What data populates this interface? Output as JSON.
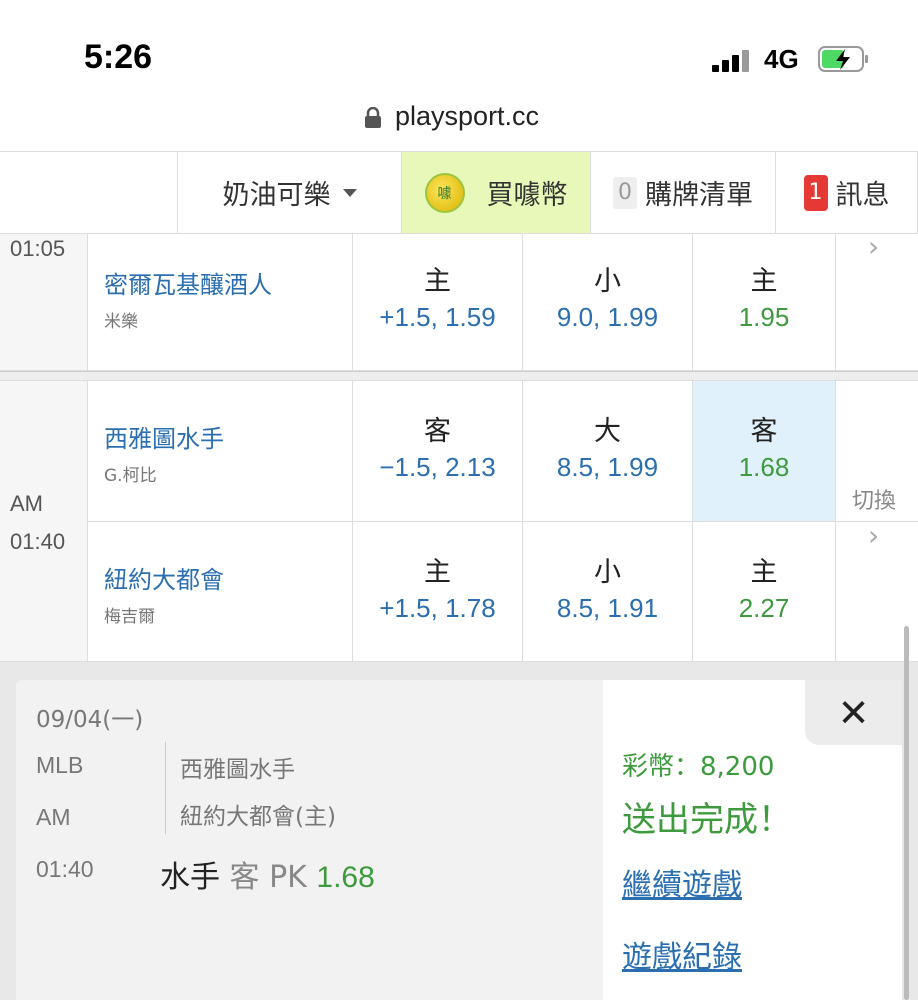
{
  "status_bar": {
    "time": "5:26",
    "network": "4G"
  },
  "url_bar": {
    "url": "playsport.cc"
  },
  "nav": {
    "user": "奶油可樂",
    "buy": "買噱幣",
    "buy_coin_glyph": "噱",
    "cart_count": "0",
    "cart": "購牌清單",
    "msg_count": "1",
    "msg": "訊息"
  },
  "game1": {
    "time": "01:05",
    "team": "密爾瓦基釀酒人",
    "pitcher": "米樂",
    "bets": [
      {
        "side": "主",
        "odds": "+1.5, 1.59",
        "color": "blue"
      },
      {
        "side": "小",
        "odds": "9.0, 1.99",
        "color": "blue"
      },
      {
        "side": "主",
        "odds": "1.95",
        "color": "green"
      }
    ]
  },
  "game2": {
    "am": "AM",
    "time": "01:40",
    "switch": "切換",
    "away": {
      "team": "西雅圖水手",
      "pitcher": "G.柯比",
      "bets": [
        {
          "side": "客",
          "odds": "−1.5, 2.13",
          "color": "blue"
        },
        {
          "side": "大",
          "odds": "8.5, 1.99",
          "color": "blue"
        },
        {
          "side": "客",
          "odds": "1.68",
          "color": "green",
          "selected": true
        }
      ]
    },
    "home": {
      "team": "紐約大都會",
      "pitcher": "梅吉爾",
      "bets": [
        {
          "side": "主",
          "odds": "+1.5, 1.78",
          "color": "blue"
        },
        {
          "side": "小",
          "odds": "8.5, 1.91",
          "color": "blue"
        },
        {
          "side": "主",
          "odds": "2.27",
          "color": "green"
        }
      ]
    }
  },
  "panel": {
    "date": "09/04(一)",
    "league": "MLB",
    "am": "AM",
    "time": "01:40",
    "team1": "西雅圖水手",
    "team2": "紐約大都會(主)",
    "pick_team": "水手",
    "pick_side": "客 PK",
    "pick_odds": "1.68",
    "coins": "彩幣：8,200",
    "done": "送出完成！",
    "continue": "繼續遊戲",
    "history": "遊戲紀錄",
    "close": "✕"
  }
}
